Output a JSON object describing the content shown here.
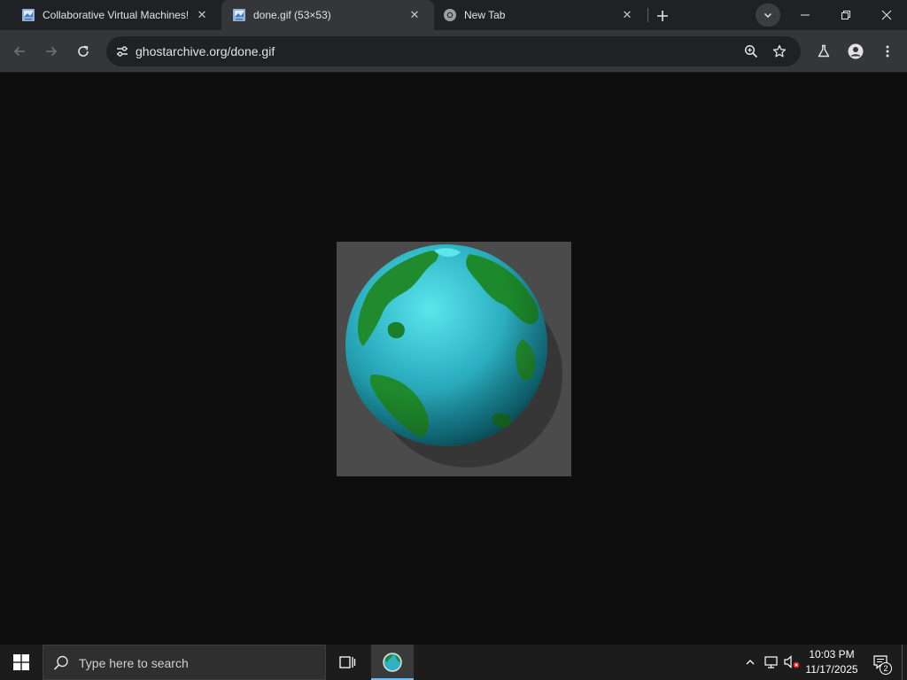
{
  "browser": {
    "tabs": [
      {
        "title": "Collaborative Virtual Machines!",
        "icon": "vm-site-favicon-icon",
        "active": false
      },
      {
        "title": "done.gif (53×53)",
        "icon": "vm-site-favicon-icon",
        "active": true
      },
      {
        "title": "New Tab",
        "icon": "chrome-icon",
        "active": false
      }
    ],
    "address_bar": {
      "url": "ghostarchive.org/done.gif"
    }
  },
  "content": {
    "image_description_icon": "spinning-globe-image"
  },
  "taskbar": {
    "search_placeholder": "Type here to search",
    "clock_time": "10:03 PM",
    "clock_date": "11/17/2025",
    "notification_count": "2"
  },
  "colors": {
    "background": "#0e0e0e",
    "tabstrip": "#202124",
    "toolbar": "#35363a",
    "image_backdrop": "#4b4b4b"
  }
}
